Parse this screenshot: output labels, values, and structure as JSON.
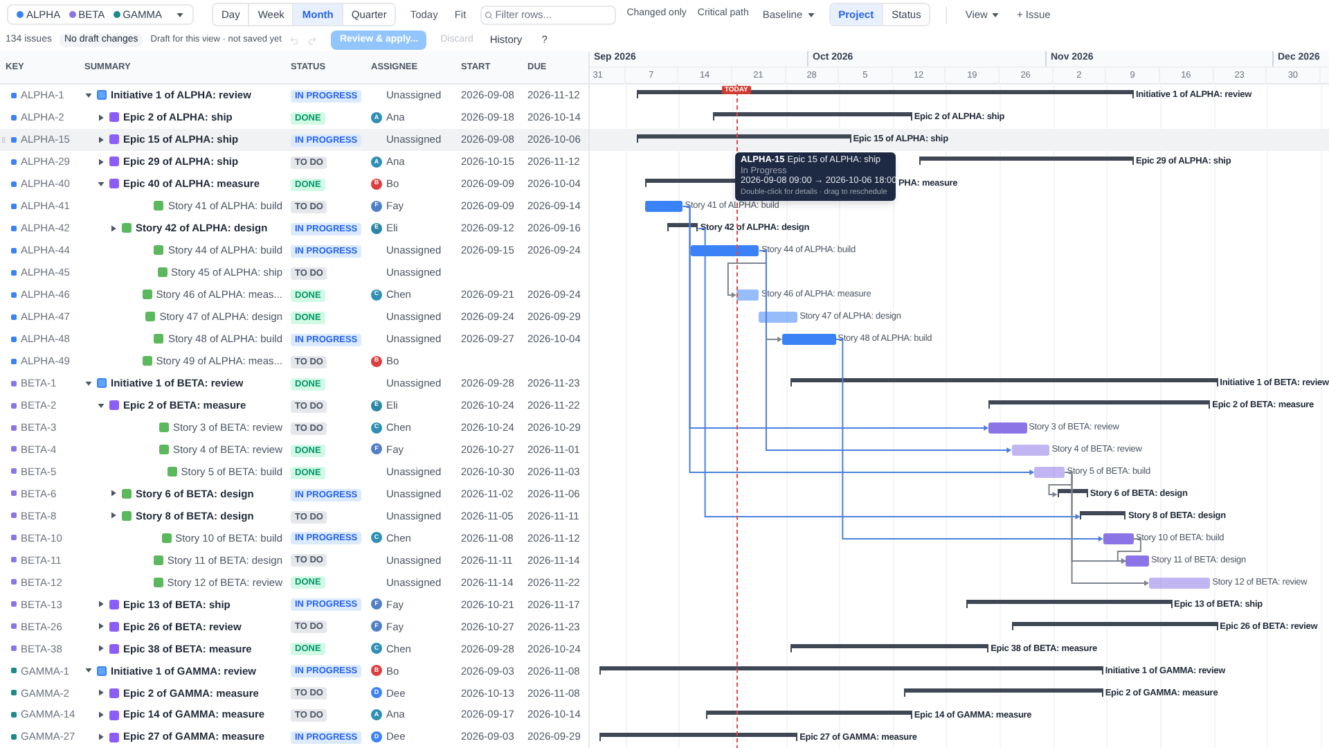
{
  "toolbar": {
    "projects": [
      {
        "name": "ALPHA",
        "color": "#3b82f6"
      },
      {
        "name": "BETA",
        "color": "#8b74e6"
      },
      {
        "name": "GAMMA",
        "color": "#1f8a8a"
      }
    ],
    "scales": [
      {
        "label": "Day",
        "selected": false
      },
      {
        "label": "Week",
        "selected": false
      },
      {
        "label": "Month",
        "selected": true
      },
      {
        "label": "Quarter",
        "selected": false
      }
    ],
    "today": "Today",
    "fit": "Fit",
    "filter_placeholder": "Filter rows...",
    "changed_only": "Changed only",
    "critical_path": "Critical path",
    "baseline": "Baseline",
    "color_modes": [
      {
        "label": "Project",
        "selected": true
      },
      {
        "label": "Status",
        "selected": false
      }
    ],
    "view": "View",
    "new_issue": "+ Issue"
  },
  "draft_bar": {
    "count": "134 issues",
    "draft_status": "No draft changes",
    "draft_note": "Draft for this view · not saved yet",
    "undo_disabled": true,
    "redo_disabled": true,
    "review": {
      "label": "Review & apply...",
      "disabled": true
    },
    "discard": {
      "label": "Discard",
      "disabled": true
    },
    "history": "History",
    "help": "?"
  },
  "columns": [
    "KEY",
    "SUMMARY",
    "STATUS",
    "ASSIGNEE",
    "START",
    "DUE"
  ],
  "timeline": {
    "months": [
      "Sep 2026",
      "Oct 2026",
      "Nov 2026",
      "Dec 2026"
    ],
    "weeks": [
      "31",
      "7",
      "14",
      "21",
      "28",
      "5",
      "12",
      "19",
      "26",
      "2",
      "9",
      "16",
      "23",
      "30"
    ],
    "today_label": "TODAY"
  },
  "issues": [
    {
      "key": "ALPHA-1",
      "color": "#3b82f6",
      "kind": "initiative",
      "summary": "Initiative 1 of ALPHA: review",
      "bar_label": "Initiative 1 of ALPHA: review",
      "status": {
        "label": "IN PROGRESS",
        "kind": "progress"
      },
      "assignee": {
        "name": "Unassigned"
      },
      "start": "2026-09-08",
      "due": "2026-11-12",
      "expanded": true,
      "hovered": false,
      "children": [
        {
          "key": "ALPHA-2",
          "color": "#3b82f6",
          "kind": "epic",
          "summary": "Epic 2 of ALPHA: ship",
          "bar_label": "Epic 2 of ALPHA: ship",
          "status": {
            "label": "DONE",
            "kind": "done"
          },
          "assignee": {
            "name": "Ana",
            "initial": "A",
            "color": "#2f8fb5"
          },
          "start": "2026-09-18",
          "due": "2026-10-14",
          "expanded": false,
          "hovered": false
        },
        {
          "key": "ALPHA-15",
          "color": "#3b82f6",
          "kind": "epic",
          "summary": "Epic 15 of ALPHA: ship",
          "bar_label": "Epic 15 of ALPHA: ship",
          "status": {
            "label": "IN PROGRESS",
            "kind": "progress"
          },
          "assignee": {
            "name": "Unassigned"
          },
          "start": "2026-09-08",
          "due": "2026-10-06",
          "expanded": false,
          "hovered": true
        },
        {
          "key": "ALPHA-29",
          "color": "#3b82f6",
          "kind": "epic",
          "summary": "Epic 29 of ALPHA: ship",
          "bar_label": "Epic 29 of ALPHA: ship",
          "status": {
            "label": "TO DO",
            "kind": "todo"
          },
          "assignee": {
            "name": "Ana",
            "initial": "A",
            "color": "#2f8fb5"
          },
          "start": "2026-10-15",
          "due": "2026-11-12",
          "expanded": false,
          "hovered": false
        },
        {
          "key": "ALPHA-40",
          "color": "#3b82f6",
          "kind": "epic",
          "summary": "Epic 40 of ALPHA: measure",
          "bar_label": "PHA: measure",
          "status": {
            "label": "DONE",
            "kind": "done"
          },
          "assignee": {
            "name": "Bo",
            "initial": "B",
            "color": "#dc3f3f"
          },
          "start": "2026-09-09",
          "due": "2026-10-04",
          "expanded": true,
          "hovered": false,
          "children": [
            {
              "key": "ALPHA-41",
              "color": "#3b82f6",
              "kind": "story",
              "summary": "Story 41 of ALPHA: build",
              "bar_label": "Story 41 of ALPHA: build",
              "status": {
                "label": "TO DO",
                "kind": "todo"
              },
              "assignee": {
                "name": "Fay",
                "initial": "F",
                "color": "#4f7fc7"
              },
              "start": "2026-09-09",
              "due": "2026-09-14",
              "hovered": false
            },
            {
              "key": "ALPHA-42",
              "color": "#3b82f6",
              "kind": "story",
              "summary": "Story 42 of ALPHA: design",
              "bar_label": "Story 42 of ALPHA: design",
              "status": {
                "label": "IN PROGRESS",
                "kind": "progress"
              },
              "assignee": {
                "name": "Eli",
                "initial": "E",
                "color": "#2a86a6"
              },
              "start": "2026-09-12",
              "due": "2026-09-16",
              "expanded": false,
              "hovered": false
            },
            {
              "key": "ALPHA-44",
              "color": "#3b82f6",
              "kind": "story",
              "summary": "Story 44 of ALPHA: build",
              "bar_label": "Story 44 of ALPHA: build",
              "status": {
                "label": "IN PROGRESS",
                "kind": "progress"
              },
              "assignee": {
                "name": "Unassigned"
              },
              "start": "2026-09-15",
              "due": "2026-09-24",
              "hovered": false
            },
            {
              "key": "ALPHA-45",
              "color": "#3b82f6",
              "kind": "story",
              "summary": "Story 45 of ALPHA: ship",
              "status": {
                "label": "TO DO",
                "kind": "todo"
              },
              "assignee": {
                "name": "Unassigned"
              },
              "hovered": false
            },
            {
              "key": "ALPHA-46",
              "color": "#3b82f6",
              "kind": "story",
              "summary": "Story 46 of ALPHA: meas...",
              "bar_label": "Story 46 of ALPHA: measure",
              "status": {
                "label": "DONE",
                "kind": "done"
              },
              "assignee": {
                "name": "Chen",
                "initial": "C",
                "color": "#2f8fb5"
              },
              "start": "2026-09-21",
              "due": "2026-09-24",
              "hovered": false
            },
            {
              "key": "ALPHA-47",
              "color": "#3b82f6",
              "kind": "story",
              "summary": "Story 47 of ALPHA: design",
              "bar_label": "Story 47 of ALPHA: design",
              "status": {
                "label": "DONE",
                "kind": "done"
              },
              "assignee": {
                "name": "Unassigned"
              },
              "start": "2026-09-24",
              "due": "2026-09-29",
              "hovered": false
            },
            {
              "key": "ALPHA-48",
              "color": "#3b82f6",
              "kind": "story",
              "summary": "Story 48 of ALPHA: build",
              "bar_label": "Story 48 of ALPHA: build",
              "status": {
                "label": "IN PROGRESS",
                "kind": "progress"
              },
              "assignee": {
                "name": "Unassigned"
              },
              "start": "2026-09-27",
              "due": "2026-10-04",
              "hovered": false
            },
            {
              "key": "ALPHA-49",
              "color": "#3b82f6",
              "kind": "story",
              "summary": "Story 49 of ALPHA: meas...",
              "status": {
                "label": "TO DO",
                "kind": "todo"
              },
              "assignee": {
                "name": "Bo",
                "initial": "B",
                "color": "#dc3f3f"
              },
              "hovered": false
            }
          ]
        }
      ]
    },
    {
      "key": "BETA-1",
      "color": "#8b74e6",
      "kind": "initiative",
      "summary": "Initiative 1 of BETA: review",
      "bar_label": "Initiative 1 of BETA: review",
      "status": {
        "label": "DONE",
        "kind": "done"
      },
      "assignee": {
        "name": "Unassigned"
      },
      "start": "2026-09-28",
      "due": "2026-11-23",
      "expanded": true,
      "hovered": false,
      "children": [
        {
          "key": "BETA-2",
          "color": "#8b74e6",
          "kind": "epic",
          "summary": "Epic 2 of BETA: measure",
          "bar_label": "Epic 2 of BETA: measure",
          "status": {
            "label": "TO DO",
            "kind": "todo"
          },
          "assignee": {
            "name": "Eli",
            "initial": "E",
            "color": "#2a86a6"
          },
          "start": "2026-10-24",
          "due": "2026-11-22",
          "expanded": true,
          "hovered": false,
          "children": [
            {
              "key": "BETA-3",
              "color": "#8b74e6",
              "kind": "story",
              "summary": "Story 3 of BETA: review",
              "bar_label": "Story 3 of BETA: review",
              "status": {
                "label": "TO DO",
                "kind": "todo"
              },
              "assignee": {
                "name": "Chen",
                "initial": "C",
                "color": "#2f8fb5"
              },
              "start": "2026-10-24",
              "due": "2026-10-29",
              "hovered": false
            },
            {
              "key": "BETA-4",
              "color": "#8b74e6",
              "kind": "story",
              "summary": "Story 4 of BETA: review",
              "bar_label": "Story 4 of BETA: review",
              "status": {
                "label": "DONE",
                "kind": "done"
              },
              "assignee": {
                "name": "Fay",
                "initial": "F",
                "color": "#4f7fc7"
              },
              "start": "2026-10-27",
              "due": "2026-11-01",
              "hovered": false
            },
            {
              "key": "BETA-5",
              "color": "#8b74e6",
              "kind": "story",
              "summary": "Story 5 of BETA: build",
              "bar_label": "Story 5 of BETA: build",
              "status": {
                "label": "DONE",
                "kind": "done"
              },
              "assignee": {
                "name": "Unassigned"
              },
              "start": "2026-10-30",
              "due": "2026-11-03",
              "hovered": false
            },
            {
              "key": "BETA-6",
              "color": "#8b74e6",
              "kind": "story",
              "summary": "Story 6 of BETA: design",
              "bar_label": "Story 6 of BETA: design",
              "status": {
                "label": "IN PROGRESS",
                "kind": "progress"
              },
              "assignee": {
                "name": "Unassigned"
              },
              "start": "2026-11-02",
              "due": "2026-11-06",
              "expanded": false,
              "hovered": false
            },
            {
              "key": "BETA-8",
              "color": "#8b74e6",
              "kind": "story",
              "summary": "Story 8 of BETA: design",
              "bar_label": "Story 8 of BETA: design",
              "status": {
                "label": "TO DO",
                "kind": "todo"
              },
              "assignee": {
                "name": "Unassigned"
              },
              "start": "2026-11-05",
              "due": "2026-11-11",
              "expanded": false,
              "hovered": false
            },
            {
              "key": "BETA-10",
              "color": "#8b74e6",
              "kind": "story",
              "summary": "Story 10 of BETA: build",
              "bar_label": "Story 10 of BETA: build",
              "status": {
                "label": "IN PROGRESS",
                "kind": "progress"
              },
              "assignee": {
                "name": "Chen",
                "initial": "C",
                "color": "#2f8fb5"
              },
              "start": "2026-11-08",
              "due": "2026-11-12",
              "hovered": false
            },
            {
              "key": "BETA-11",
              "color": "#8b74e6",
              "kind": "story",
              "summary": "Story 11 of BETA: design",
              "bar_label": "Story 11 of BETA: design",
              "status": {
                "label": "TO DO",
                "kind": "todo"
              },
              "assignee": {
                "name": "Unassigned"
              },
              "start": "2026-11-11",
              "due": "2026-11-14",
              "hovered": false
            },
            {
              "key": "BETA-12",
              "color": "#8b74e6",
              "kind": "story",
              "summary": "Story 12 of BETA: review",
              "bar_label": "Story 12 of BETA: review",
              "status": {
                "label": "DONE",
                "kind": "done"
              },
              "assignee": {
                "name": "Unassigned"
              },
              "start": "2026-11-14",
              "due": "2026-11-22",
              "hovered": false
            }
          ]
        },
        {
          "key": "BETA-13",
          "color": "#8b74e6",
          "kind": "epic",
          "summary": "Epic 13 of BETA: ship",
          "bar_label": "Epic 13 of BETA: ship",
          "status": {
            "label": "IN PROGRESS",
            "kind": "progress"
          },
          "assignee": {
            "name": "Fay",
            "initial": "F",
            "color": "#4f7fc7"
          },
          "start": "2026-10-21",
          "due": "2026-11-17",
          "expanded": false,
          "hovered": false
        },
        {
          "key": "BETA-26",
          "color": "#8b74e6",
          "kind": "epic",
          "summary": "Epic 26 of BETA: review",
          "bar_label": "Epic 26 of BETA: review",
          "status": {
            "label": "TO DO",
            "kind": "todo"
          },
          "assignee": {
            "name": "Fay",
            "initial": "F",
            "color": "#4f7fc7"
          },
          "start": "2026-10-27",
          "due": "2026-11-23",
          "expanded": false,
          "hovered": false
        },
        {
          "key": "BETA-38",
          "color": "#8b74e6",
          "kind": "epic",
          "summary": "Epic 38 of BETA: measure",
          "bar_label": "Epic 38 of BETA: measure",
          "status": {
            "label": "DONE",
            "kind": "done"
          },
          "assignee": {
            "name": "Chen",
            "initial": "C",
            "color": "#2f8fb5"
          },
          "start": "2026-09-28",
          "due": "2026-10-24",
          "expanded": false,
          "hovered": false
        }
      ]
    },
    {
      "key": "GAMMA-1",
      "color": "#1f8a8a",
      "kind": "initiative",
      "summary": "Initiative 1 of GAMMA: review",
      "bar_label": "Initiative 1 of GAMMA: review",
      "status": {
        "label": "IN PROGRESS",
        "kind": "progress"
      },
      "assignee": {
        "name": "Bo",
        "initial": "B",
        "color": "#dc3f3f"
      },
      "start": "2026-09-03",
      "due": "2026-11-08",
      "expanded": true,
      "hovered": false,
      "children": [
        {
          "key": "GAMMA-2",
          "color": "#1f8a8a",
          "kind": "epic",
          "summary": "Epic 2 of GAMMA: measure",
          "bar_label": "Epic 2 of GAMMA: measure",
          "status": {
            "label": "TO DO",
            "kind": "todo"
          },
          "assignee": {
            "name": "Dee",
            "initial": "D",
            "color": "#3b82f6"
          },
          "start": "2026-10-13",
          "due": "2026-11-08",
          "expanded": false,
          "hovered": false
        },
        {
          "key": "GAMMA-14",
          "color": "#1f8a8a",
          "kind": "epic",
          "summary": "Epic 14 of GAMMA: measure",
          "bar_label": "Epic 14 of GAMMA: measure",
          "status": {
            "label": "TO DO",
            "kind": "todo"
          },
          "assignee": {
            "name": "Ana",
            "initial": "A",
            "color": "#2f8fb5"
          },
          "start": "2026-09-17",
          "due": "2026-10-14",
          "expanded": false,
          "hovered": false
        },
        {
          "key": "GAMMA-27",
          "color": "#1f8a8a",
          "kind": "epic",
          "summary": "Epic 27 of GAMMA: measure",
          "bar_label": "Epic 27 of GAMMA: measure",
          "status": {
            "label": "IN PROGRESS",
            "kind": "progress"
          },
          "assignee": {
            "name": "Dee",
            "initial": "D",
            "color": "#3b82f6"
          },
          "start": "2026-09-03",
          "due": "2026-09-29",
          "expanded": false,
          "hovered": false
        }
      ]
    }
  ],
  "tooltip": {
    "key": "ALPHA-15",
    "title": "Epic 15 of ALPHA: ship",
    "status": "In Progress",
    "dates": "2026-09-08 09:00 → 2026-10-06 18:00",
    "hint": "Double-click for details · drag to reschedule"
  }
}
